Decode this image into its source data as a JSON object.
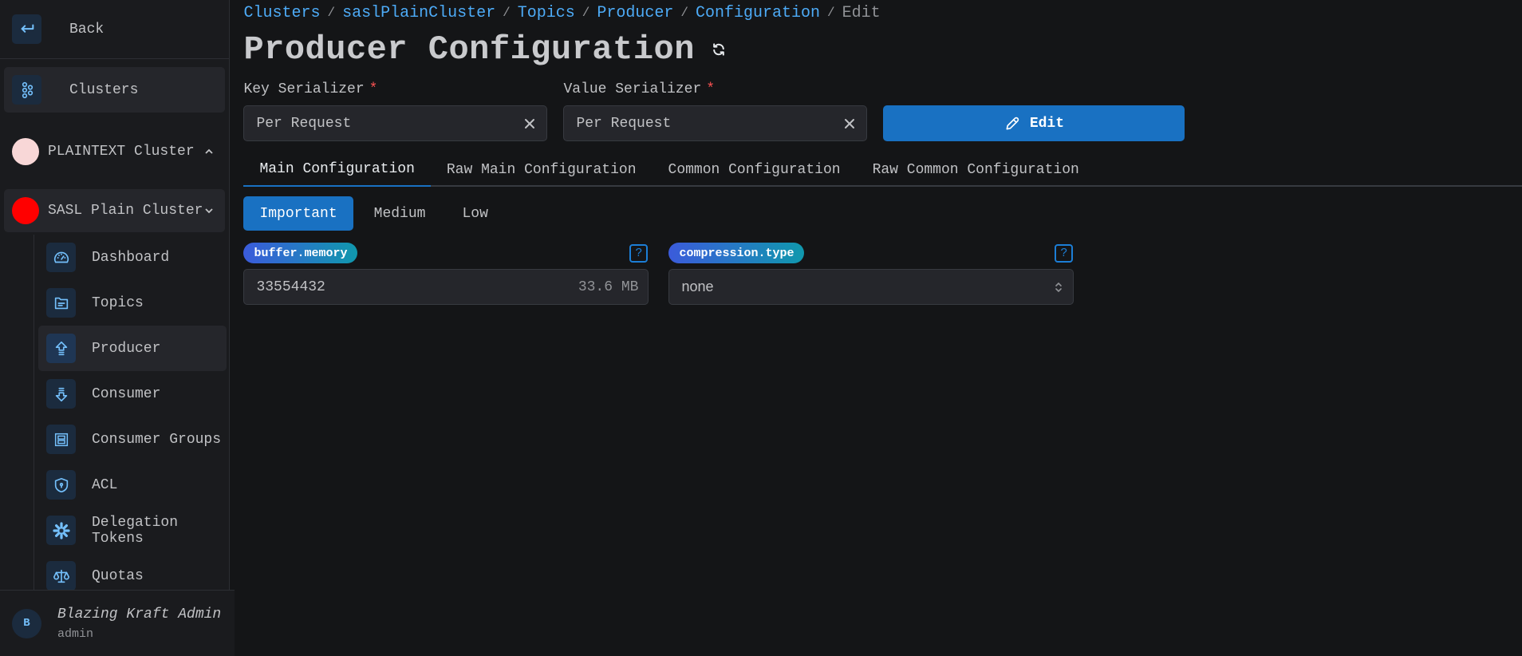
{
  "sidebar": {
    "back_label": "Back",
    "clusters_label": "Clusters",
    "clusters": [
      {
        "name": "PLAINTEXT Cluster",
        "color": "#f8d7d7",
        "expanded": false
      },
      {
        "name": "SASL Plain Cluster",
        "color": "#ff0000",
        "expanded": true
      }
    ],
    "nav_items": [
      {
        "label": "Dashboard",
        "icon": "gauge-icon"
      },
      {
        "label": "Topics",
        "icon": "folder-icon"
      },
      {
        "label": "Producer",
        "icon": "upload-arrow-icon",
        "active": true
      },
      {
        "label": "Consumer",
        "icon": "download-arrow-icon"
      },
      {
        "label": "Consumer Groups",
        "icon": "group-frame-icon"
      },
      {
        "label": "ACL",
        "icon": "shield-lock-icon"
      },
      {
        "label": "Delegation Tokens",
        "icon": "asterisk-icon"
      },
      {
        "label": "Quotas",
        "icon": "scale-icon"
      }
    ],
    "user": {
      "initial": "B",
      "name": "Blazing Kraft Admin",
      "role": "admin"
    }
  },
  "breadcrumb": [
    {
      "label": "Clusters",
      "link": true
    },
    {
      "label": "saslPlainCluster",
      "link": true
    },
    {
      "label": "Topics",
      "link": true
    },
    {
      "label": "Producer",
      "link": true
    },
    {
      "label": "Configuration",
      "link": true
    },
    {
      "label": "Edit",
      "link": false
    }
  ],
  "header": {
    "title": "Producer Configuration"
  },
  "serializers": {
    "key": {
      "label": "Key Serializer",
      "required_mark": "*",
      "value": "Per Request"
    },
    "value": {
      "label": "Value Serializer",
      "required_mark": "*",
      "value": "Per Request"
    },
    "edit_label": "Edit"
  },
  "tabs": [
    {
      "label": "Main Configuration",
      "active": true
    },
    {
      "label": "Raw Main Configuration"
    },
    {
      "label": "Common Configuration"
    },
    {
      "label": "Raw Common Configuration"
    }
  ],
  "levels": [
    {
      "label": "Important",
      "active": true
    },
    {
      "label": "Medium"
    },
    {
      "label": "Low"
    }
  ],
  "configs": [
    {
      "key": "buffer.memory",
      "value": "33554432",
      "hint": "33.6 MB",
      "help": "?"
    },
    {
      "key": "compression.type",
      "value": "none",
      "help": "?"
    }
  ],
  "colors": {
    "accent": "#1971c2",
    "link": "#4dabf7",
    "background": "#141517",
    "sidebar": "#1a1b1e"
  }
}
